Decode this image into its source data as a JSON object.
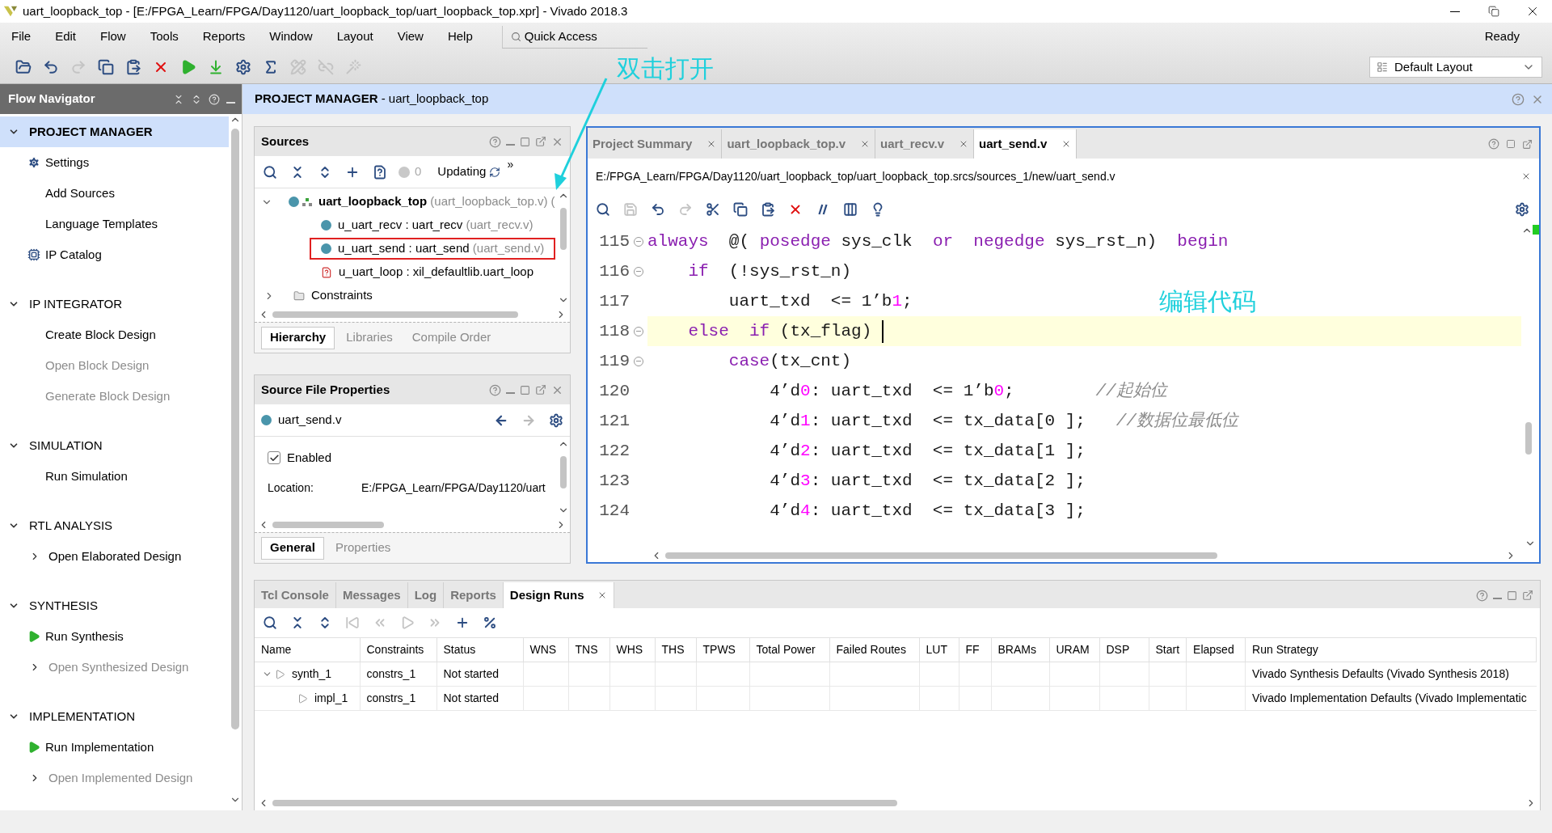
{
  "window": {
    "title": "uart_loopback_top - [E:/FPGA_Learn/FPGA/Day1120/uart_loopback_top/uart_loopback_top.xpr] - Vivado 2018.3"
  },
  "menu": [
    "File",
    "Edit",
    "Flow",
    "Tools",
    "Reports",
    "Window",
    "Layout",
    "View",
    "Help"
  ],
  "quick_access": {
    "placeholder": "Quick Access"
  },
  "status": "Ready",
  "layout_select": {
    "value": "Default Layout"
  },
  "toolbar": [
    {
      "kind": "open",
      "disabled": false
    },
    {
      "kind": "undo",
      "disabled": false
    },
    {
      "kind": "redo",
      "disabled": true
    },
    {
      "kind": "copy",
      "disabled": false
    },
    {
      "kind": "paste",
      "disabled": false
    },
    {
      "kind": "delete",
      "disabled": false
    },
    {
      "kind": "run",
      "disabled": false
    },
    {
      "kind": "bitstream",
      "disabled": false
    },
    {
      "kind": "settings",
      "disabled": false
    },
    {
      "kind": "sigma",
      "disabled": false
    },
    {
      "kind": "ruler",
      "disabled": true
    },
    {
      "kind": "unlink",
      "disabled": true
    },
    {
      "kind": "wand",
      "disabled": true
    }
  ],
  "flow_navigator": {
    "title": "Flow Navigator",
    "sections": [
      {
        "title": "PROJECT MANAGER",
        "selected": true,
        "expanded": true,
        "items": [
          {
            "label": "Settings",
            "kind": "gear",
            "disabled": false
          },
          {
            "label": "Add Sources",
            "kind": "plain",
            "disabled": false
          },
          {
            "label": "Language Templates",
            "kind": "plain",
            "disabled": false
          },
          {
            "label": "IP Catalog",
            "kind": "chip",
            "disabled": false
          }
        ]
      },
      {
        "title": "IP INTEGRATOR",
        "selected": false,
        "expanded": true,
        "items": [
          {
            "label": "Create Block Design",
            "kind": "plain",
            "disabled": false
          },
          {
            "label": "Open Block Design",
            "kind": "plain",
            "disabled": true
          },
          {
            "label": "Generate Block Design",
            "kind": "plain",
            "disabled": true
          }
        ]
      },
      {
        "title": "SIMULATION",
        "selected": false,
        "expanded": true,
        "items": [
          {
            "label": "Run Simulation",
            "kind": "plain",
            "disabled": false
          }
        ]
      },
      {
        "title": "RTL ANALYSIS",
        "selected": false,
        "expanded": true,
        "items": [
          {
            "label": "Open Elaborated Design",
            "kind": "submenu",
            "disabled": false
          }
        ]
      },
      {
        "title": "SYNTHESIS",
        "selected": false,
        "expanded": true,
        "items": [
          {
            "label": "Run Synthesis",
            "kind": "run",
            "disabled": false
          },
          {
            "label": "Open Synthesized Design",
            "kind": "submenu",
            "disabled": true
          }
        ]
      },
      {
        "title": "IMPLEMENTATION",
        "selected": false,
        "expanded": true,
        "items": [
          {
            "label": "Run Implementation",
            "kind": "run",
            "disabled": false
          },
          {
            "label": "Open Implemented Design",
            "kind": "submenu",
            "disabled": true
          }
        ]
      }
    ]
  },
  "header": {
    "title": "**PROJECT MANAGER** - uart_loopback_top"
  },
  "sources": {
    "title": "Sources",
    "toolbar": [
      {
        "kind": "search",
        "disabled": false
      },
      {
        "kind": "collapse",
        "disabled": false
      },
      {
        "kind": "expand",
        "disabled": false
      },
      {
        "kind": "add",
        "disabled": false
      },
      {
        "kind": "unknown",
        "disabled": false
      }
    ],
    "count": "0",
    "progress": "Updating",
    "more": "»",
    "tree": [
      {
        "name": "uart_loopback_top",
        "file": "(uart_loopback_top.v) (",
        "kind": "top",
        "expanded": true,
        "highlighted": false,
        "children": [
          {
            "name": "u_uart_recv : uart_recv",
            "file": "(uart_recv.v)",
            "kind": "dot",
            "highlighted": false
          },
          {
            "name": "u_uart_send : uart_send",
            "file": "(uart_send.v)",
            "kind": "dot",
            "highlighted": true
          },
          {
            "name": "u_uart_loop : xil_defaultlib.uart_loop",
            "kind": "missing",
            "highlighted": false
          }
        ]
      },
      {
        "name": "Constraints",
        "kind": "folder",
        "expanded": false,
        "highlighted": false
      }
    ],
    "tabs": [
      {
        "label": "Hierarchy",
        "selected": true
      },
      {
        "label": "Libraries",
        "selected": false
      },
      {
        "label": "Compile Order",
        "selected": false
      }
    ]
  },
  "properties": {
    "title": "Source File Properties",
    "file": "uart_send.v",
    "enabled": {
      "label": "Enabled",
      "checked": true
    },
    "location": {
      "label": "Location:",
      "value": "E:/FPGA_Learn/FPGA/Day1120/uart"
    },
    "tabs": [
      {
        "label": "General",
        "selected": true
      },
      {
        "label": "Properties",
        "selected": false
      }
    ]
  },
  "editor": {
    "tabs": [
      {
        "label": "Project Summary",
        "selected": false
      },
      {
        "label": "uart_loopback_top.v",
        "selected": false
      },
      {
        "label": "uart_recv.v",
        "selected": false
      },
      {
        "label": "uart_send.v",
        "selected": true
      }
    ],
    "path": "E:/FPGA_Learn/FPGA/Day1120/uart_loopback_top/uart_loopback_top.srcs/sources_1/new/uart_send.v",
    "toolbar": [
      {
        "kind": "search",
        "disabled": false
      },
      {
        "kind": "save",
        "disabled": true
      },
      {
        "kind": "undo",
        "disabled": false
      },
      {
        "kind": "redo",
        "disabled": true
      },
      {
        "kind": "cut",
        "disabled": false
      },
      {
        "kind": "copy",
        "disabled": false
      },
      {
        "kind": "paste",
        "disabled": false
      },
      {
        "kind": "delete",
        "disabled": false
      },
      {
        "kind": "comment",
        "disabled": false
      },
      {
        "kind": "columns",
        "disabled": false
      },
      {
        "kind": "hint",
        "disabled": false
      }
    ],
    "lines": [
      {
        "number": "115",
        "fold": true,
        "current": false,
        "tokens": [
          {
            "kind": "keyword",
            "text": "always"
          },
          {
            "kind": "plain",
            "text": "  @( "
          },
          {
            "kind": "keyword",
            "text": "posedge"
          },
          {
            "kind": "plain",
            "text": " sys_clk  "
          },
          {
            "kind": "keyword",
            "text": "or"
          },
          {
            "kind": "keyword",
            "text": "  negedge"
          },
          {
            "kind": "plain",
            "text": " sys_rst_n)  "
          },
          {
            "kind": "keyword",
            "text": "begin"
          }
        ]
      },
      {
        "number": "116",
        "fold": true,
        "current": false,
        "tokens": [
          {
            "kind": "keyword",
            "text": "    if"
          },
          {
            "kind": "plain",
            "text": "  (!sys_rst_n)"
          }
        ]
      },
      {
        "number": "117",
        "fold": false,
        "current": false,
        "tokens": [
          {
            "kind": "plain",
            "text": "        uart_txd  <= 1’b"
          },
          {
            "kind": "number",
            "text": "1"
          },
          {
            "kind": "plain",
            "text": ";"
          }
        ]
      },
      {
        "number": "118",
        "fold": true,
        "current": true,
        "tokens": [
          {
            "kind": "keyword",
            "text": "    else  if"
          },
          {
            "kind": "plain",
            "text": " (tx_flag) "
          }
        ]
      },
      {
        "number": "119",
        "fold": true,
        "current": false,
        "tokens": [
          {
            "kind": "keyword",
            "text": "        case"
          },
          {
            "kind": "plain",
            "text": "(tx_cnt)"
          }
        ]
      },
      {
        "number": "120",
        "fold": false,
        "current": false,
        "tokens": [
          {
            "kind": "plain",
            "text": "            4’d"
          },
          {
            "kind": "number",
            "text": "0"
          },
          {
            "kind": "plain",
            "text": ": uart_txd  <= 1’b"
          },
          {
            "kind": "number",
            "text": "0"
          },
          {
            "kind": "plain",
            "text": ";        "
          },
          {
            "kind": "comment",
            "text": "//起始位"
          }
        ]
      },
      {
        "number": "121",
        "fold": false,
        "current": false,
        "tokens": [
          {
            "kind": "plain",
            "text": "            4’d"
          },
          {
            "kind": "number",
            "text": "1"
          },
          {
            "kind": "plain",
            "text": ": uart_txd  <= tx_data[0 ];   "
          },
          {
            "kind": "comment",
            "text": "//数据位最低位"
          }
        ]
      },
      {
        "number": "122",
        "fold": false,
        "current": false,
        "tokens": [
          {
            "kind": "plain",
            "text": "            4’d"
          },
          {
            "kind": "number",
            "text": "2"
          },
          {
            "kind": "plain",
            "text": ": uart_txd  <= tx_data[1 ];"
          }
        ]
      },
      {
        "number": "123",
        "fold": false,
        "current": false,
        "tokens": [
          {
            "kind": "plain",
            "text": "            4’d"
          },
          {
            "kind": "number",
            "text": "3"
          },
          {
            "kind": "plain",
            "text": ": uart_txd  <= tx_data[2 ];"
          }
        ]
      },
      {
        "number": "124",
        "fold": false,
        "current": false,
        "tokens": [
          {
            "kind": "plain",
            "text": "            4’d"
          },
          {
            "kind": "number",
            "text": "4"
          },
          {
            "kind": "plain",
            "text": ": uart_txd  <= tx_data[3 ];"
          }
        ]
      }
    ]
  },
  "console": {
    "tabs": [
      {
        "label": "Tcl Console",
        "selected": false
      },
      {
        "label": "Messages",
        "selected": false
      },
      {
        "label": "Log",
        "selected": false
      },
      {
        "label": "Reports",
        "selected": false
      },
      {
        "label": "Design Runs",
        "selected": true
      }
    ],
    "toolbar": [
      {
        "kind": "search",
        "disabled": false
      },
      {
        "kind": "collapse",
        "disabled": false
      },
      {
        "kind": "expand",
        "disabled": false
      },
      {
        "kind": "first",
        "disabled": true
      },
      {
        "kind": "rewind",
        "disabled": true
      },
      {
        "kind": "play",
        "disabled": true
      },
      {
        "kind": "forward",
        "disabled": true
      },
      {
        "kind": "add",
        "disabled": false
      },
      {
        "kind": "percent",
        "disabled": false
      }
    ],
    "columns": [
      "Name",
      "Constraints",
      "Status",
      "WNS",
      "TNS",
      "WHS",
      "THS",
      "TPWS",
      "Total Power",
      "Failed Routes",
      "LUT",
      "FF",
      "BRAMs",
      "URAM",
      "DSP",
      "Start",
      "Elapsed",
      "Run Strategy"
    ],
    "rows": [
      {
        "name": "synth_1",
        "constraints": "constrs_1",
        "status": "Not started",
        "run_strategy": "Vivado Synthesis Defaults (Vivado Synthesis 2018)",
        "expanded": true,
        "children": [
          {
            "name": "impl_1",
            "constraints": "constrs_1",
            "status": "Not started",
            "run_strategy": "Vivado Implementation Defaults (Vivado Implementatic"
          }
        ]
      }
    ]
  },
  "annotations": [
    {
      "text": "双击打开"
    },
    {
      "text": "编辑代码"
    }
  ]
}
